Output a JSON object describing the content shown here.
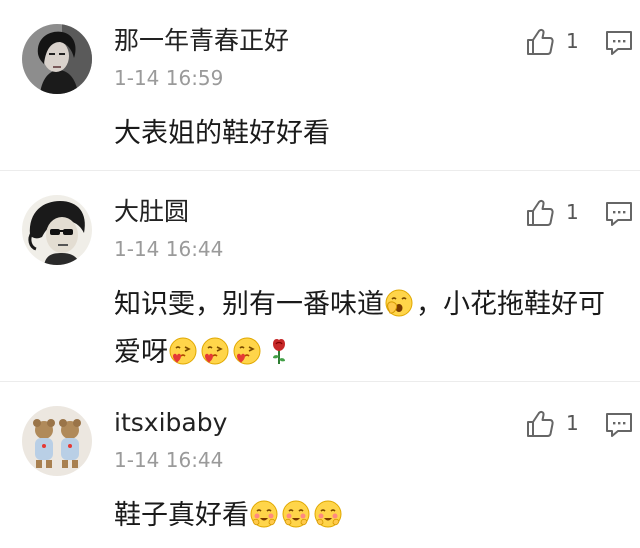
{
  "comments": [
    {
      "username": "那一年青春正好",
      "time": "1-14 16:59",
      "text": "大表姐的鞋好好看",
      "likes": "1",
      "avatar_icon": "portrait-avatar-dark-hair",
      "emojis": []
    },
    {
      "username": "大肚圆",
      "time": "1-14 16:44",
      "text": "知识雯，别有一番味道",
      "text_after_emoji": "，小花拖鞋好可爱呀",
      "likes": "1",
      "avatar_icon": "sketch-avatar-sunglasses",
      "inline_emoji": "yawn-emoji",
      "emojis": [
        "heart-kiss-emoji",
        "heart-kiss-emoji",
        "heart-kiss-emoji",
        "rose-emoji"
      ]
    },
    {
      "username": "itsxibaby",
      "time": "1-14 16:44",
      "text": "鞋子真好看",
      "likes": "1",
      "avatar_icon": "teddy-bears-avatar",
      "emojis": [
        "blush-emoji",
        "blush-emoji",
        "blush-emoji"
      ]
    }
  ],
  "colors": {
    "text": "#1a1a1a",
    "meta": "#9a9a9a",
    "icon": "#666666",
    "divider": "#ececec"
  }
}
